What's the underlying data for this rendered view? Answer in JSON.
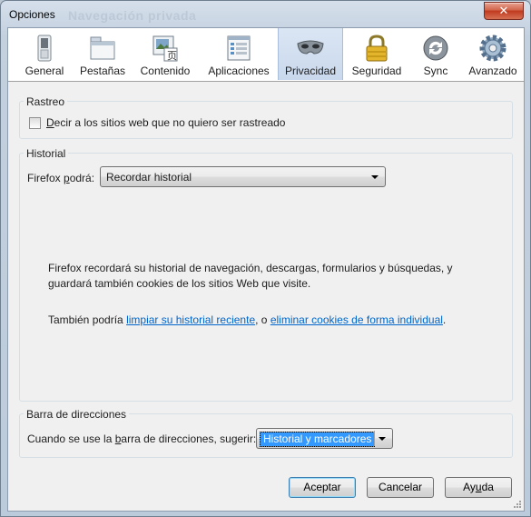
{
  "window": {
    "title": "Opciones",
    "background_title": "Navegación privada",
    "close_symbol": "✕"
  },
  "toolbar": {
    "selected_tab": "Privacidad",
    "tabs": [
      {
        "label": "General",
        "icon": "switch-icon"
      },
      {
        "label": "Pestañas",
        "icon": "tabs-window-icon"
      },
      {
        "label": "Contenido",
        "icon": "content-image-icon"
      },
      {
        "label": "Aplicaciones",
        "icon": "applications-list-icon"
      },
      {
        "label": "Privacidad",
        "icon": "privacy-mask-icon"
      },
      {
        "label": "Seguridad",
        "icon": "padlock-icon"
      },
      {
        "label": "Sync",
        "icon": "sync-icon"
      },
      {
        "label": "Avanzado",
        "icon": "gear-icon"
      }
    ]
  },
  "tracking": {
    "group_title": "Rastreo",
    "checkbox_label_accesskey": "D",
    "checkbox_label_rest": "ecir a los sitios web que no quiero ser rastreado",
    "checked": false
  },
  "history": {
    "group_title": "Historial",
    "mode_label_pre": "Firefox ",
    "mode_label_accesskey": "p",
    "mode_label_post": "odrá:",
    "mode_value": "Recordar historial",
    "description_line1": "Firefox recordará su historial de navegación, descargas, formularios y búsquedas, y",
    "description_line2": "guardará también cookies de los sitios Web que visite.",
    "also_prefix": "También podría ",
    "link_clear_history": "limpiar su historial reciente",
    "also_middle": ", o ",
    "link_remove_cookies": "eliminar cookies de forma individual",
    "also_suffix": "."
  },
  "location_bar": {
    "group_title": "Barra de direcciones",
    "suggest_label_pre": "Cuando se use la ",
    "suggest_label_accesskey": "b",
    "suggest_label_post": "arra de direcciones, sugerir:",
    "suggest_value": "Historial y marcadores"
  },
  "buttons": {
    "accept": "Aceptar",
    "cancel": "Cancelar",
    "help_pre": "Ay",
    "help_accesskey": "u",
    "help_post": "da"
  },
  "colors": {
    "link": "#0066cc",
    "selection": "#3399ff",
    "close_button": "#c03a1f"
  }
}
